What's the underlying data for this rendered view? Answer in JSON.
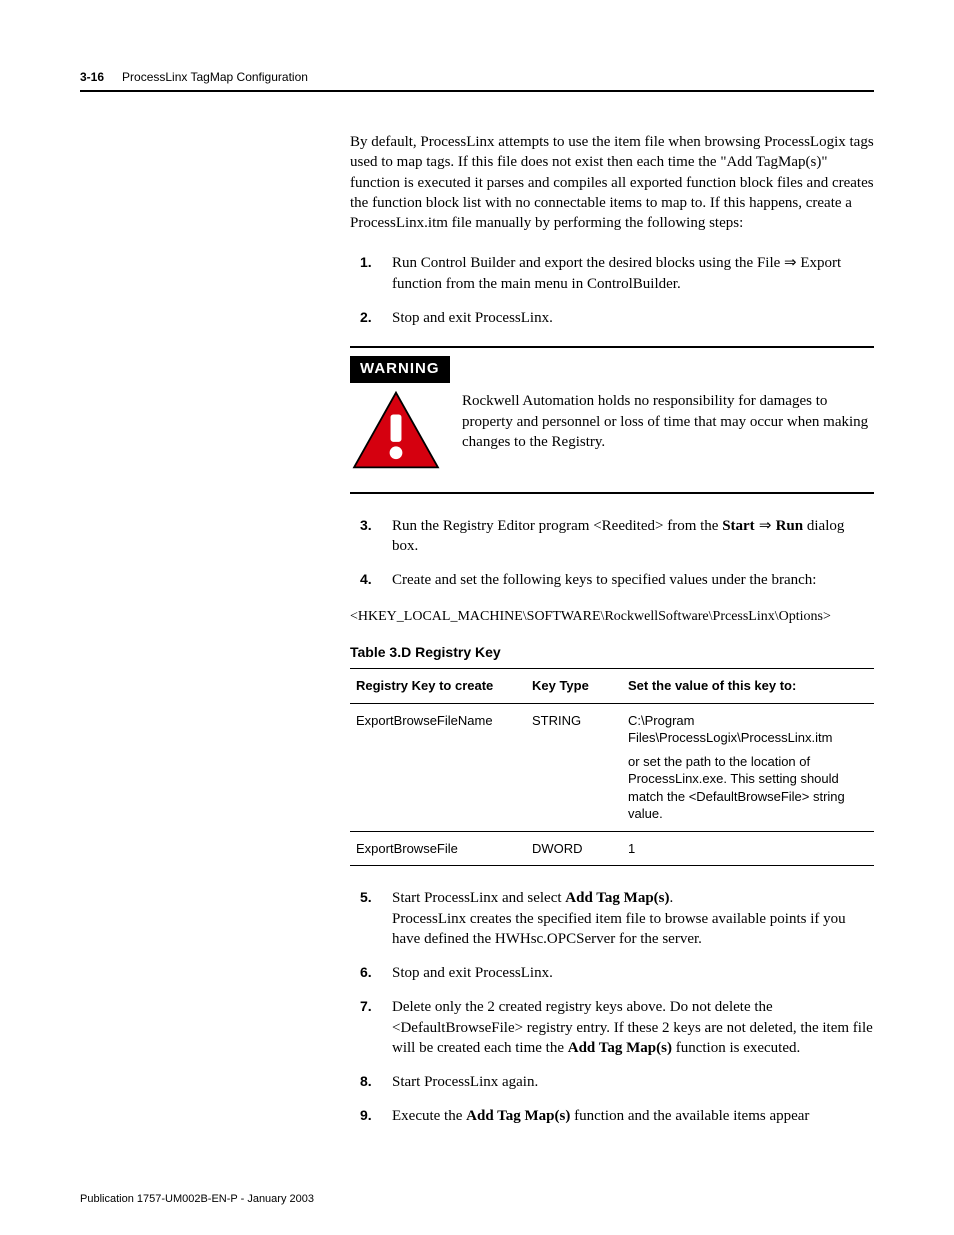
{
  "header": {
    "page_num": "3-16",
    "section_title": "ProcessLinx TagMap Configuration"
  },
  "intro": "By default, ProcessLinx attempts to use the item file when browsing ProcessLogix tags used to map tags. If this file does not exist then each time the \"Add TagMap(s)\" function is executed it parses and compiles all exported function block files and creates the function block list with no connectable items to map to. If this happens, create a ProcessLinx.itm file manually by performing the following steps:",
  "steps_a": [
    {
      "n": "1.",
      "text_pre": "Run Control Builder and export the desired blocks using the File ",
      "arrow": "⇒",
      "text_post": " Export function from the main menu in ControlBuilder."
    },
    {
      "n": "2.",
      "text": "Stop and exit ProcessLinx."
    }
  ],
  "warning": {
    "label": "WARNING",
    "text": "Rockwell Automation holds no responsibility for damages to property and personnel or loss of time that may occur when making changes to the Registry."
  },
  "steps_b": [
    {
      "n": "3.",
      "text_pre": "Run the Registry Editor program <Reedited> from the ",
      "bold1": "Start",
      "arrow": " ⇒ ",
      "bold2": "Run",
      "text_post": " dialog box."
    },
    {
      "n": "4.",
      "text": "Create and set the following keys to specified values under the branch:"
    }
  ],
  "regpath": "<HKEY_LOCAL_MACHINE\\SOFTWARE\\RockwellSoftware\\PrcessLinx\\Options>",
  "table": {
    "caption": "Table 3.D Registry Key",
    "headers": [
      "Registry Key to create",
      "Key Type",
      "Set the value of this key to:"
    ],
    "rows": [
      {
        "c1": "ExportBrowseFileName",
        "c2": "STRING",
        "c3a": "C:\\Program Files\\ProcessLogix\\ProcessLinx.itm",
        "c3b": "or set the path to  the location of ProcessLinx.exe. This setting should match the <DefaultBrowseFile> string value."
      },
      {
        "c1": "ExportBrowseFile",
        "c2": "DWORD",
        "c3a": "1",
        "c3b": ""
      }
    ]
  },
  "steps_c": [
    {
      "n": "5.",
      "text_pre": "Start ProcessLinx and select ",
      "bold": "Add Tag Map(s)",
      "text_post": ".",
      "line2": "ProcessLinx creates the specified item file to browse available points if you have defined the HWHsc.OPCServer for the server."
    },
    {
      "n": "6.",
      "text": "Stop and exit ProcessLinx."
    },
    {
      "n": "7.",
      "text_pre": "Delete only the 2 created registry keys above. Do not delete the <DefaultBrowseFile> registry entry. If these 2 keys are not deleted, the item file will be created each time the ",
      "bold": "Add Tag Map(s)",
      "text_post": " function is executed."
    },
    {
      "n": "8.",
      "text": "Start ProcessLinx again."
    },
    {
      "n": "9.",
      "text_pre": "Execute the ",
      "bold": "Add Tag Map(s)",
      "text_post": " function and the available items appear"
    }
  ],
  "footer": "Publication 1757-UM002B-EN-P - January 2003"
}
